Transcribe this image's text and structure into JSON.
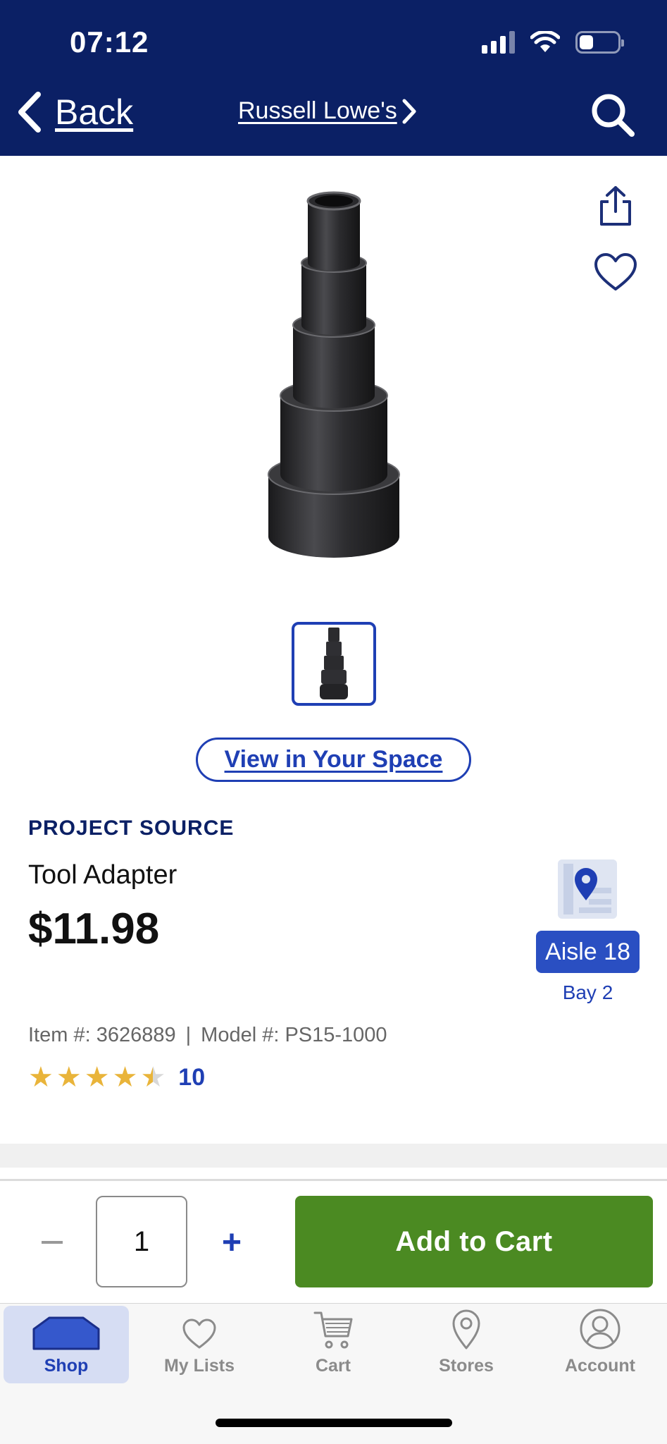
{
  "status_bar": {
    "time": "07:12",
    "battery_percent": 30
  },
  "nav": {
    "back_label": "Back",
    "store_label": "Russell Lowe's"
  },
  "product": {
    "brand": "PROJECT SOURCE",
    "title": "Tool Adapter",
    "price": "$11.98",
    "item_number": "Item #: 3626889",
    "separator": "|",
    "model_number": "Model #: PS15-1000",
    "rating_value": 4.5,
    "rating_stars": [
      "★",
      "★",
      "★",
      "★",
      "★"
    ],
    "review_count": "10",
    "view_in_space_label": "View in Your Space"
  },
  "location": {
    "aisle": "Aisle 18",
    "bay": "Bay 2"
  },
  "cart": {
    "quantity": "1",
    "minus_icon": "minus-icon",
    "plus_label": "+",
    "add_to_cart_label": "Add to Cart"
  },
  "tabs": [
    {
      "label": "Shop",
      "icon": "shop-icon",
      "active": true
    },
    {
      "label": "My Lists",
      "icon": "heart-icon",
      "active": false
    },
    {
      "label": "Cart",
      "icon": "cart-icon",
      "active": false
    },
    {
      "label": "Stores",
      "icon": "location-pin-icon",
      "active": false
    },
    {
      "label": "Account",
      "icon": "user-icon",
      "active": false
    }
  ],
  "colors": {
    "header": "#0b2065",
    "accent": "#1f3fb4",
    "add_to_cart": "#4b8a22",
    "star": "#e9b43a"
  }
}
